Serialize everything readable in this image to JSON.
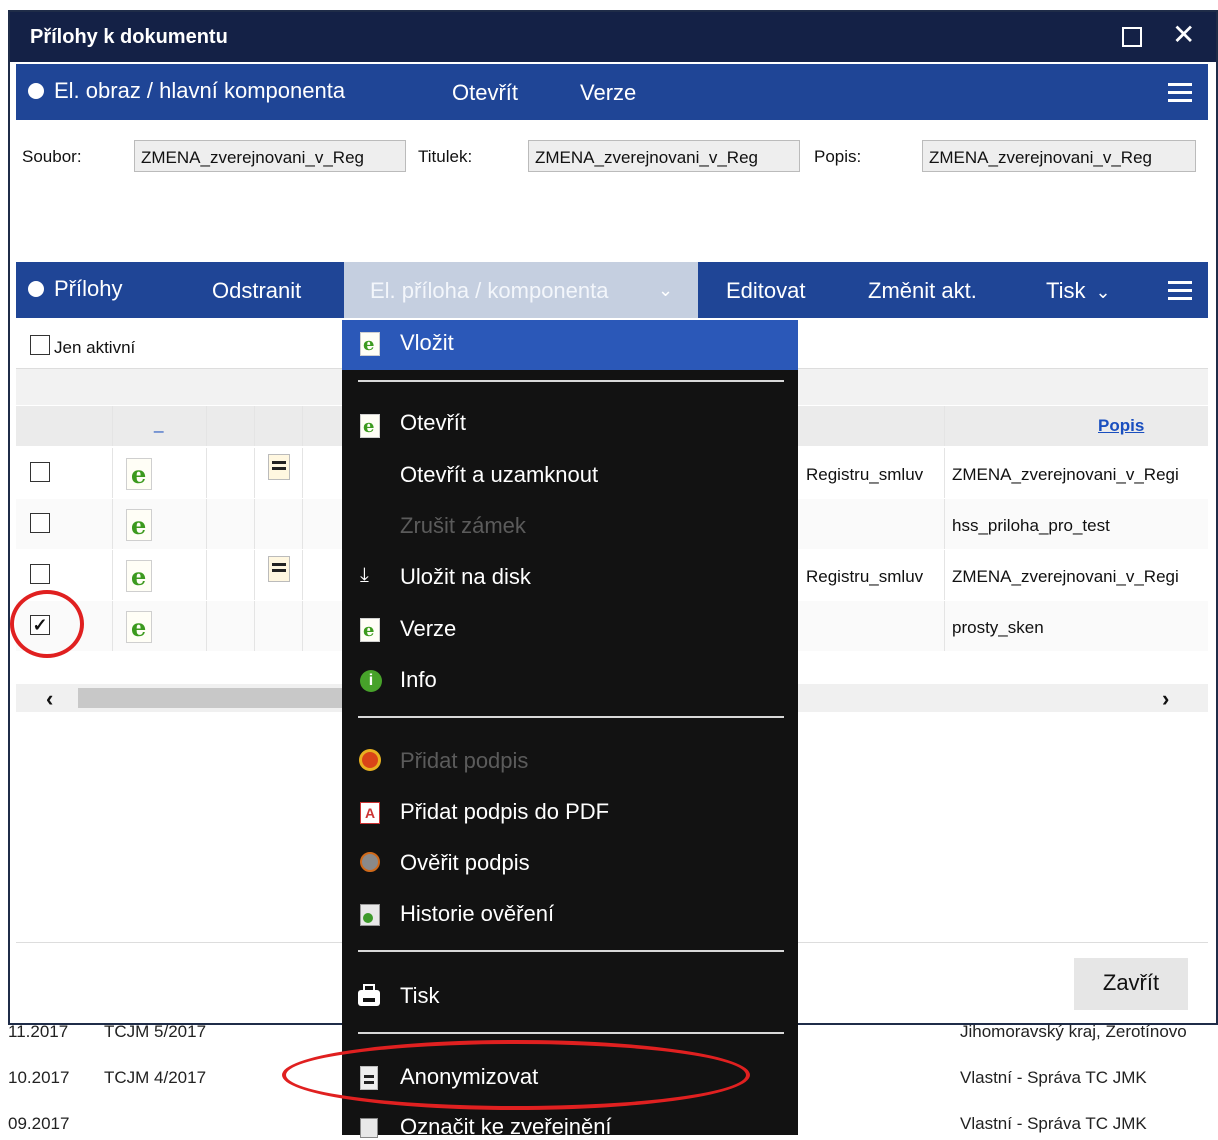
{
  "dialog": {
    "title": "Přílohy k dokumentu",
    "main_band": {
      "label": "El. obraz / hlavní komponenta",
      "open": "Otevřít",
      "versions": "Verze"
    },
    "fields": {
      "file_label": "Soubor:",
      "file_value": "ZMENA_zverejnovani_v_Reg",
      "caption_label": "Titulek:",
      "caption_value": "ZMENA_zverejnovani_v_Reg",
      "desc_label": "Popis:",
      "desc_value": "ZMENA_zverejnovani_v_Reg"
    },
    "attach_band": {
      "label": "Přílohy",
      "remove": "Odstranit",
      "component": "El. příloha / komponenta",
      "edit": "Editovat",
      "change": "Změnit akt.",
      "print": "Tisk"
    },
    "only_active": "Jen aktivní",
    "grid": {
      "col_marker": "_",
      "col_desc": "Popis",
      "rows": [
        {
          "name_tail": "Registru_smluv",
          "desc": "ZMENA_zverejnovani_v_Regi",
          "checked": false
        },
        {
          "name_tail": "",
          "desc": "hss_priloha_pro_test",
          "checked": false
        },
        {
          "name_tail": "Registru_smluv",
          "desc": "ZMENA_zverejnovani_v_Regi",
          "checked": false
        },
        {
          "name_tail": "",
          "desc": "prosty_sken",
          "checked": true
        }
      ]
    },
    "close_label": "Zavřít"
  },
  "menu": {
    "insert": "Vložit",
    "open": "Otevřít",
    "open_lock": "Otevřít a uzamknout",
    "cancel_lock": "Zrušit zámek",
    "save_disk": "Uložit na disk",
    "versions": "Verze",
    "info": "Info",
    "add_sign": "Přidat podpis",
    "add_sign_pdf": "Přidat podpis do PDF",
    "verify_sign": "Ověřit podpis",
    "verify_history": "Historie ověření",
    "print": "Tisk",
    "anonymize": "Anonymizovat",
    "mark_publish": "Označit ke zveřejnění"
  },
  "background_rows": [
    {
      "date": "11.2017",
      "ref": "TCJM 5/2017",
      "party": "Jihomoravský kraj, Žerotínovo"
    },
    {
      "date": "10.2017",
      "ref": "TCJM 4/2017",
      "party": "Vlastní - Správa TC JMK"
    },
    {
      "date": "09.2017",
      "ref": "",
      "party": "Vlastní - Správa TC JMK"
    }
  ],
  "colors": {
    "title_bar": "#142146",
    "band": "#1f4596",
    "menu_bg": "#121212",
    "highlight": "#2b58b8",
    "annotation": "#e02020"
  }
}
